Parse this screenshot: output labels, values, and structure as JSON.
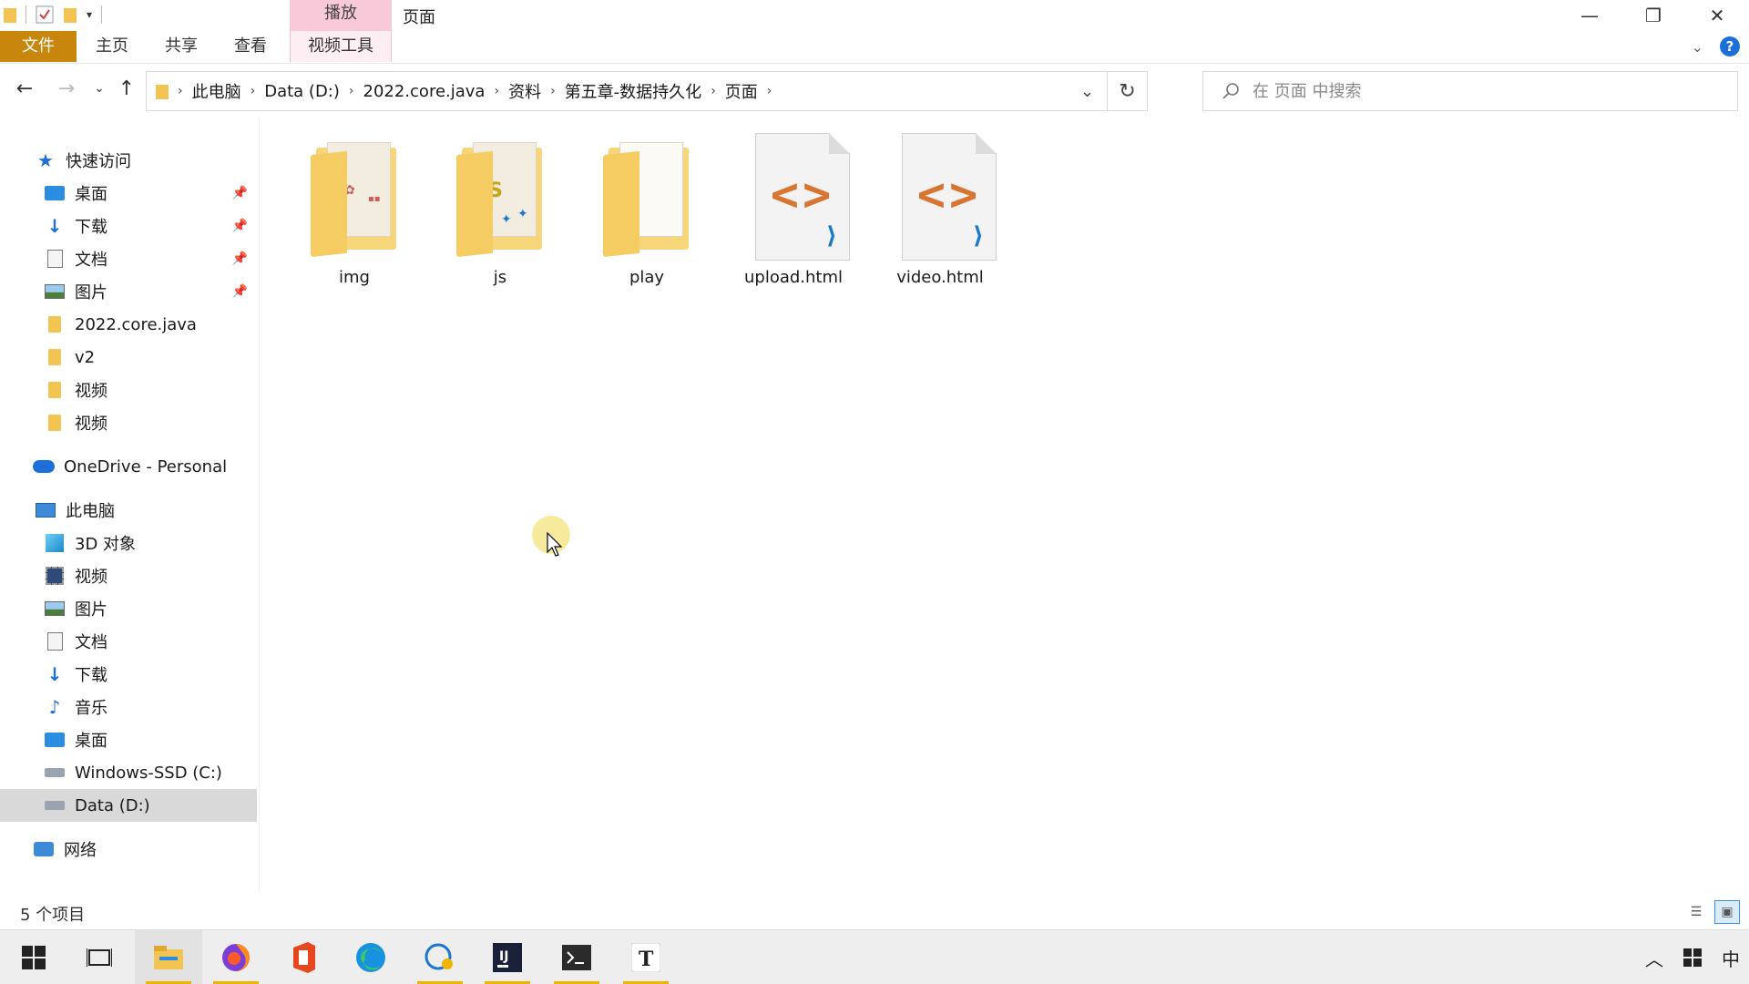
{
  "window": {
    "title": "页面",
    "context_tab_group": "播放"
  },
  "ribbon": {
    "tabs": [
      "文件",
      "主页",
      "共享",
      "查看",
      "视频工具"
    ]
  },
  "address_bar": {
    "crumbs": [
      "此电脑",
      "Data (D:)",
      "2022.core.java",
      "资料",
      "第五章-数据持久化",
      "页面"
    ]
  },
  "search": {
    "placeholder": "在 页面 中搜索"
  },
  "nav": {
    "quick_access": "快速访问",
    "quick_items": [
      "桌面",
      "下载",
      "文档",
      "图片",
      "2022.core.java",
      "v2",
      "视频",
      "视频"
    ],
    "onedrive": "OneDrive - Personal",
    "this_pc": "此电脑",
    "pc_items": [
      "3D 对象",
      "视频",
      "图片",
      "文档",
      "下载",
      "音乐",
      "桌面",
      "Windows-SSD (C:)",
      "Data (D:)"
    ],
    "network": "网络"
  },
  "files": [
    {
      "name": "img",
      "type": "folder"
    },
    {
      "name": "js",
      "type": "folder"
    },
    {
      "name": "play",
      "type": "folder"
    },
    {
      "name": "upload.html",
      "type": "html"
    },
    {
      "name": "video.html",
      "type": "html"
    }
  ],
  "status": {
    "item_count": "5 个项目"
  },
  "taskbar": {
    "ime": "中"
  },
  "colors": {
    "file_tab": "#c8860d",
    "context_tab": "#f8c9d8",
    "accent": "#1b6fd6",
    "selected_nav": "#d9d9d9"
  }
}
